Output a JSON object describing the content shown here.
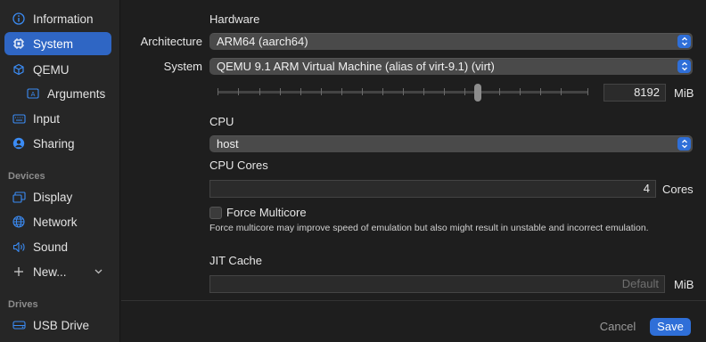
{
  "sidebar": {
    "items": [
      {
        "label": "Information",
        "icon": "info-icon"
      },
      {
        "label": "System",
        "icon": "chip-icon"
      },
      {
        "label": "QEMU",
        "icon": "cube-icon"
      },
      {
        "label": "Arguments",
        "icon": "text-cursor-icon"
      },
      {
        "label": "Input",
        "icon": "keyboard-icon"
      },
      {
        "label": "Sharing",
        "icon": "person-circle-icon"
      }
    ],
    "devices_header": "Devices",
    "devices": [
      {
        "label": "Display",
        "icon": "display-icon"
      },
      {
        "label": "Network",
        "icon": "globe-icon"
      },
      {
        "label": "Sound",
        "icon": "speaker-icon"
      },
      {
        "label": "New...",
        "icon": "plus-icon"
      }
    ],
    "drives_header": "Drives",
    "drives": [
      {
        "label": "USB Drive",
        "icon": "drive-icon"
      }
    ],
    "active_color": "#2f66c4",
    "icon_color": "#3b8cf5"
  },
  "hardware": {
    "section_label": "Hardware",
    "architecture_label": "Architecture",
    "architecture_value": "ARM64 (aarch64)",
    "system_label": "System",
    "system_value": "QEMU 9.1 ARM Virtual Machine (alias of virt-9.1) (virt)",
    "memory_value": "8192",
    "memory_unit": "MiB",
    "memory_slider_fraction": 0.7
  },
  "cpu": {
    "section_label": "CPU",
    "value": "host",
    "cores_label": "CPU Cores",
    "cores_value": "4",
    "cores_unit": "Cores",
    "force_multicore_label": "Force Multicore",
    "force_multicore_checked": false,
    "force_multicore_hint": "Force multicore may improve speed of emulation but also might result in unstable and incorrect emulation."
  },
  "jit": {
    "section_label": "JIT Cache",
    "placeholder": "Default",
    "unit": "MiB"
  },
  "footer": {
    "cancel_label": "Cancel",
    "save_label": "Save"
  }
}
